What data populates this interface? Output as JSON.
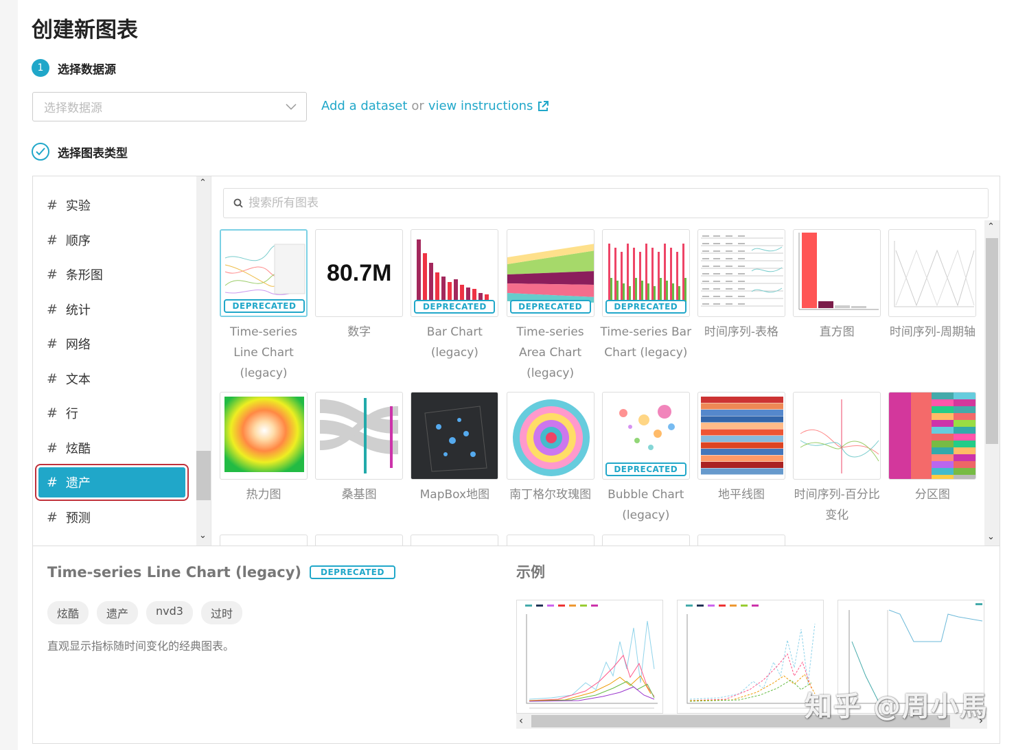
{
  "page": {
    "title": "创建新图表"
  },
  "step1": {
    "number": "1",
    "label": "选择数据源"
  },
  "datasource": {
    "placeholder": "选择数据源",
    "add_link": "Add a dataset",
    "or": "or",
    "view_link": "view instructions"
  },
  "step2": {
    "label": "选择图表类型"
  },
  "categories": [
    "实验",
    "顺序",
    "条形图",
    "统计",
    "网络",
    "文本",
    "行",
    "炫酷",
    "遗产",
    "预测"
  ],
  "active_category": "遗产",
  "search": {
    "placeholder": "搜索所有图表"
  },
  "deprecated_label": "DEPRECATED",
  "charts": [
    {
      "label": "Time-series Line Chart (legacy)",
      "deprecated": true,
      "thumb": "line",
      "selected": true
    },
    {
      "label": "数字",
      "deprecated": false,
      "thumb": "number",
      "value": "80.7M"
    },
    {
      "label": "Bar Chart (legacy)",
      "deprecated": true,
      "thumb": "bar"
    },
    {
      "label": "Time-series Area Chart (legacy)",
      "deprecated": true,
      "thumb": "area"
    },
    {
      "label": "Time-series Bar Chart (legacy)",
      "deprecated": true,
      "thumb": "tsbar"
    },
    {
      "label": "时间序列-表格",
      "deprecated": false,
      "thumb": "table"
    },
    {
      "label": "直方图",
      "deprecated": false,
      "thumb": "histogram"
    },
    {
      "label": "时间序列-周期轴",
      "deprecated": false,
      "thumb": "period"
    },
    {
      "label": "热力图",
      "deprecated": false,
      "thumb": "heat"
    },
    {
      "label": "桑基图",
      "deprecated": false,
      "thumb": "sankey"
    },
    {
      "label": "MapBox地图",
      "deprecated": false,
      "thumb": "mapbox"
    },
    {
      "label": "南丁格尔玫瑰图",
      "deprecated": false,
      "thumb": "rose"
    },
    {
      "label": "Bubble Chart (legacy)",
      "deprecated": true,
      "thumb": "bubble"
    },
    {
      "label": "地平线图",
      "deprecated": false,
      "thumb": "horizon"
    },
    {
      "label": "时间序列-百分比变化",
      "deprecated": false,
      "thumb": "pct"
    },
    {
      "label": "分区图",
      "deprecated": false,
      "thumb": "partition"
    }
  ],
  "details": {
    "title": "Time-series Line Chart (legacy)",
    "tags": [
      "炫酷",
      "遗产",
      "nvd3",
      "过时"
    ],
    "description": "直观显示指标随时间变化的经典图表。",
    "examples_title": "示例"
  },
  "watermark": "知乎 @周小馬",
  "colors": {
    "accent": "#20a7c9",
    "selection_outline": "#c0303a"
  }
}
